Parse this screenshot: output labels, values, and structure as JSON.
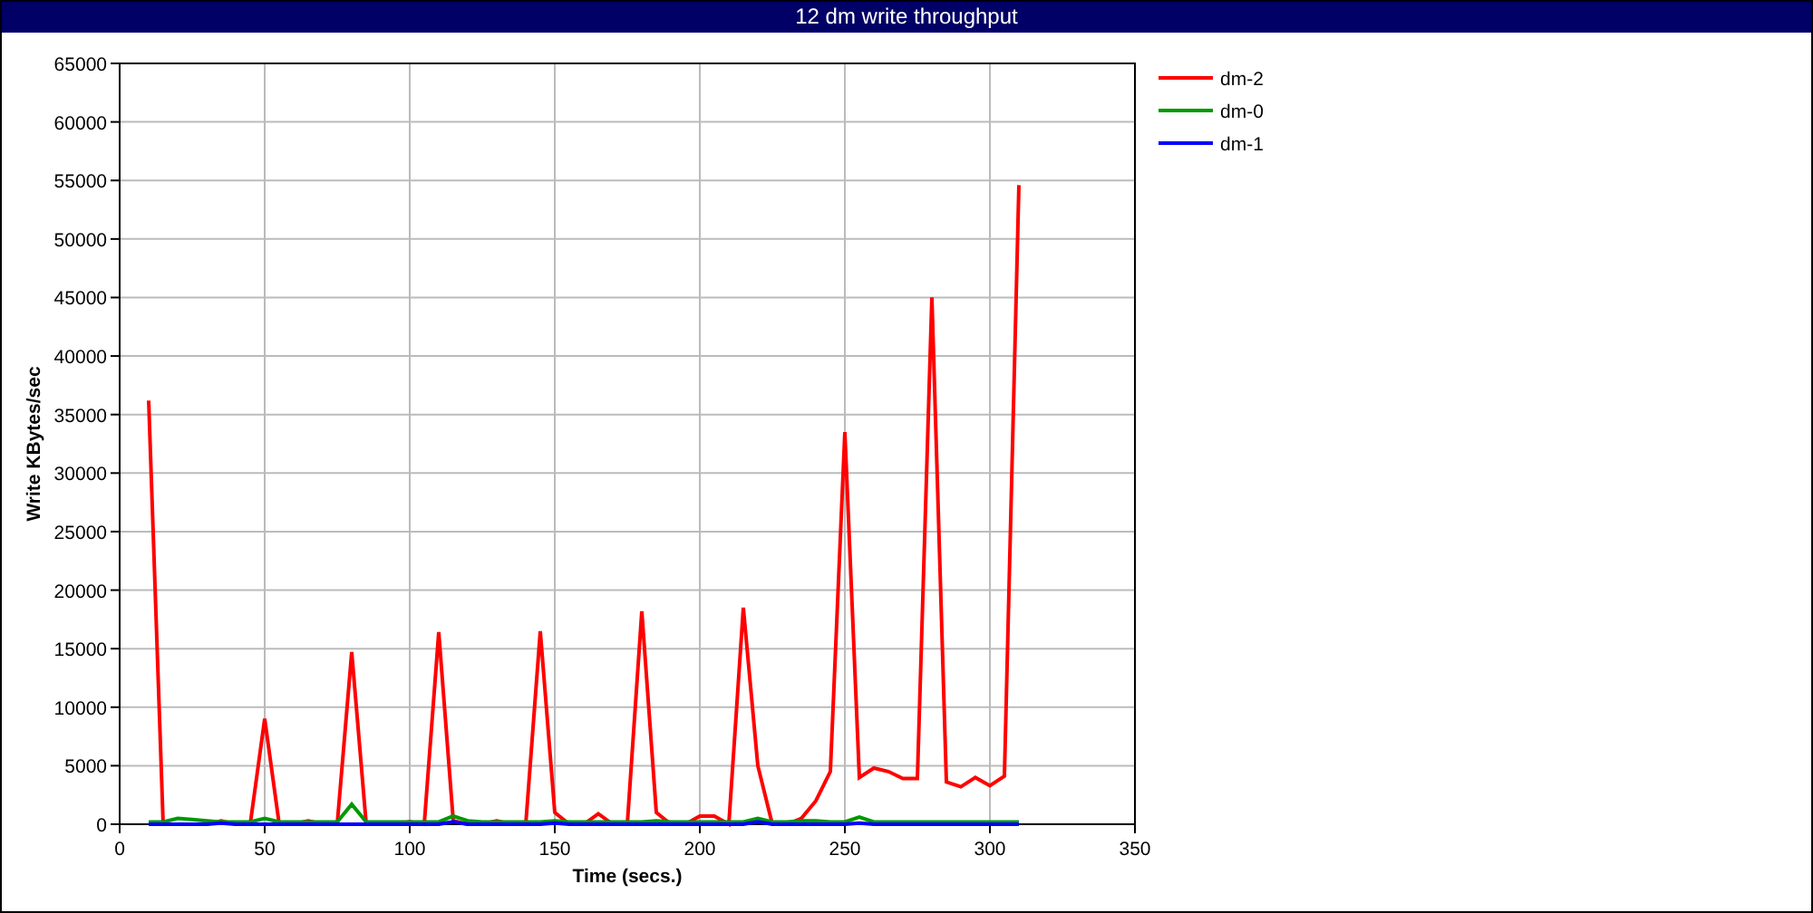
{
  "window": {
    "title": "12 dm write throughput"
  },
  "chart_data": {
    "type": "line",
    "grid": true,
    "legend": true,
    "xlabel": "Time (secs.)",
    "ylabel": "Write KBytes/sec",
    "xlim": [
      0,
      350
    ],
    "ylim": [
      0,
      65000
    ],
    "xticks": [
      0,
      50,
      100,
      150,
      200,
      250,
      300,
      350
    ],
    "yticks": [
      0,
      5000,
      10000,
      15000,
      20000,
      25000,
      30000,
      35000,
      40000,
      45000,
      50000,
      55000,
      60000,
      65000
    ],
    "x": [
      10,
      15,
      20,
      25,
      30,
      35,
      40,
      45,
      50,
      55,
      60,
      65,
      70,
      75,
      80,
      85,
      90,
      95,
      100,
      105,
      110,
      115,
      120,
      125,
      130,
      135,
      140,
      145,
      150,
      155,
      160,
      165,
      170,
      175,
      180,
      185,
      190,
      195,
      200,
      205,
      210,
      215,
      220,
      225,
      230,
      235,
      240,
      245,
      250,
      255,
      260,
      265,
      270,
      275,
      280,
      285,
      290,
      295,
      300,
      305,
      310
    ],
    "series": [
      {
        "name": "dm-2",
        "color": "#ff0000",
        "values": [
          36200,
          0,
          0,
          0,
          0,
          300,
          0,
          0,
          9000,
          0,
          0,
          300,
          0,
          0,
          14700,
          0,
          0,
          0,
          200,
          0,
          16400,
          300,
          0,
          0,
          300,
          0,
          0,
          16500,
          1000,
          0,
          0,
          900,
          0,
          0,
          18200,
          1000,
          0,
          0,
          700,
          700,
          0,
          18500,
          5000,
          0,
          0,
          500,
          2000,
          4500,
          33500,
          4000,
          4800,
          4500,
          3900,
          3900,
          45000,
          3600,
          3200,
          4000,
          3300,
          4100,
          54600
        ]
      },
      {
        "name": "dm-0",
        "color": "#009900",
        "values": [
          200,
          200,
          500,
          400,
          300,
          200,
          200,
          200,
          500,
          200,
          200,
          200,
          200,
          200,
          1700,
          200,
          200,
          200,
          200,
          200,
          200,
          700,
          300,
          200,
          200,
          200,
          200,
          200,
          300,
          200,
          200,
          200,
          200,
          200,
          200,
          300,
          200,
          200,
          200,
          200,
          200,
          200,
          500,
          200,
          200,
          300,
          300,
          200,
          200,
          600,
          200,
          200,
          200,
          200,
          200,
          200,
          200,
          200,
          200,
          200,
          200
        ]
      },
      {
        "name": "dm-1",
        "color": "#0000ff",
        "values": [
          0,
          0,
          0,
          0,
          0,
          100,
          0,
          0,
          0,
          0,
          0,
          0,
          0,
          0,
          0,
          0,
          0,
          0,
          0,
          0,
          0,
          200,
          0,
          0,
          0,
          0,
          0,
          0,
          100,
          0,
          0,
          0,
          0,
          0,
          0,
          0,
          0,
          0,
          0,
          0,
          0,
          0,
          200,
          0,
          0,
          0,
          0,
          0,
          0,
          100,
          0,
          0,
          0,
          0,
          0,
          0,
          0,
          0,
          0,
          0,
          0
        ]
      }
    ]
  }
}
